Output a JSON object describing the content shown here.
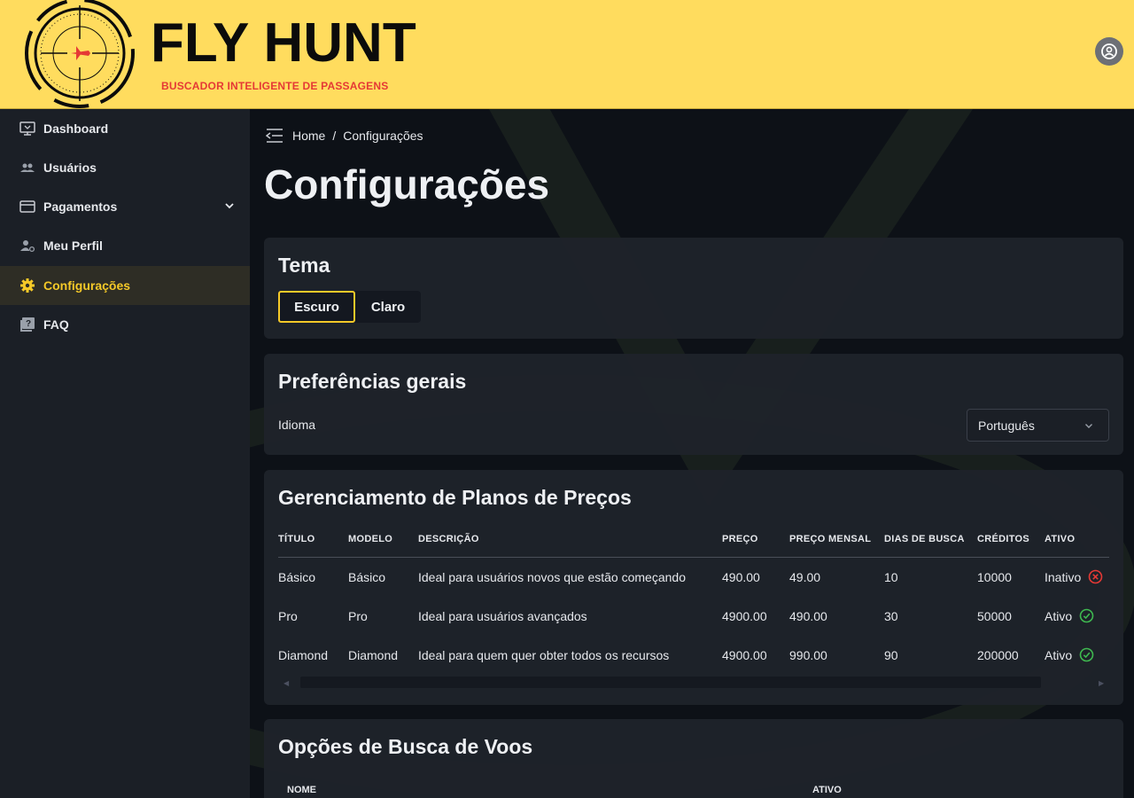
{
  "header": {
    "brand_title": "FLY HUNT",
    "brand_subtitle": "BUSCADOR INTELIGENTE DE PASSAGENS",
    "accent_color": "#ffdc5e",
    "subtitle_color": "#e53935"
  },
  "sidebar": {
    "items": [
      {
        "label": "Dashboard",
        "icon": "monitor-icon"
      },
      {
        "label": "Usuários",
        "icon": "users-icon"
      },
      {
        "label": "Pagamentos",
        "icon": "credit-card-icon"
      },
      {
        "label": "Meu Perfil",
        "icon": "user-settings-icon"
      },
      {
        "label": "Configurações",
        "icon": "gear-icon",
        "active": true
      },
      {
        "label": "FAQ",
        "icon": "help-book-icon"
      }
    ],
    "active_color": "#f5c928"
  },
  "breadcrumb": {
    "home": "Home",
    "separator": "/",
    "current": "Configurações"
  },
  "page_title": "Configurações",
  "theme_card": {
    "title": "Tema",
    "options": [
      "Escuro",
      "Claro"
    ],
    "selected": "Escuro"
  },
  "prefs_card": {
    "title": "Preferências gerais",
    "language_label": "Idioma",
    "language_value": "Português"
  },
  "plans_card": {
    "title": "Gerenciamento de Planos de Preços",
    "columns": [
      "TÍTULO",
      "MODELO",
      "DESCRIÇÃO",
      "PREÇO",
      "PREÇO MENSAL",
      "DIAS DE BUSCA",
      "CRÉDITOS",
      "ATIVO"
    ],
    "rows": [
      {
        "titulo": "Básico",
        "modelo": "Básico",
        "descricao": "Ideal para usuários novos que estão começando",
        "preco": "490.00",
        "preco_mensal": "49.00",
        "dias": "10",
        "creditos": "10000",
        "ativo": "Inativo",
        "status_icon": "x-circle-icon"
      },
      {
        "titulo": "Pro",
        "modelo": "Pro",
        "descricao": "Ideal para usuários avançados",
        "preco": "4900.00",
        "preco_mensal": "490.00",
        "dias": "30",
        "creditos": "50000",
        "ativo": "Ativo",
        "status_icon": "check-circle-icon"
      },
      {
        "titulo": "Diamond",
        "modelo": "Diamond",
        "descricao": "Ideal para quem quer obter todos os recursos",
        "preco": "4900.00",
        "preco_mensal": "990.00",
        "dias": "90",
        "creditos": "200000",
        "ativo": "Ativo",
        "status_icon": "check-circle-icon"
      }
    ],
    "inactive_color": "#e53935",
    "active_color": "#3fb950"
  },
  "search_card": {
    "title": "Opções de Busca de Voos",
    "columns": [
      "NOME",
      "ATIVO"
    ]
  }
}
